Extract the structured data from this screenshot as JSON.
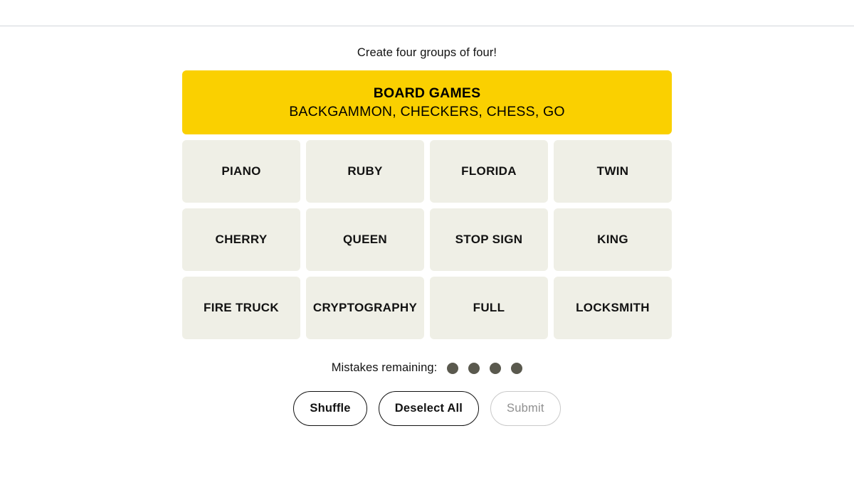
{
  "header": {
    "bar_visible": true
  },
  "game": {
    "subtitle": "Create four groups of four!",
    "solved_groups": [
      {
        "title": "BOARD GAMES",
        "words_line": "BACKGAMMON, CHECKERS, CHESS, GO",
        "color": "#fad000",
        "words": [
          "BACKGAMMON",
          "CHECKERS",
          "CHESS",
          "GO"
        ]
      }
    ],
    "tiles": [
      {
        "label": "PIANO"
      },
      {
        "label": "RUBY"
      },
      {
        "label": "FLORIDA"
      },
      {
        "label": "TWIN"
      },
      {
        "label": "CHERRY"
      },
      {
        "label": "QUEEN"
      },
      {
        "label": "STOP SIGN"
      },
      {
        "label": "KING"
      },
      {
        "label": "FIRE TRUCK"
      },
      {
        "label": "CRYPTOGRAPHY"
      },
      {
        "label": "FULL"
      },
      {
        "label": "LOCKSMITH"
      }
    ],
    "tile_color": "#efefe6",
    "mistakes": {
      "label": "Mistakes remaining:",
      "remaining": 4,
      "dot_color": "#5a594e"
    },
    "actions": {
      "shuffle": "Shuffle",
      "deselect": "Deselect All",
      "submit": "Submit",
      "submit_disabled": true
    }
  }
}
